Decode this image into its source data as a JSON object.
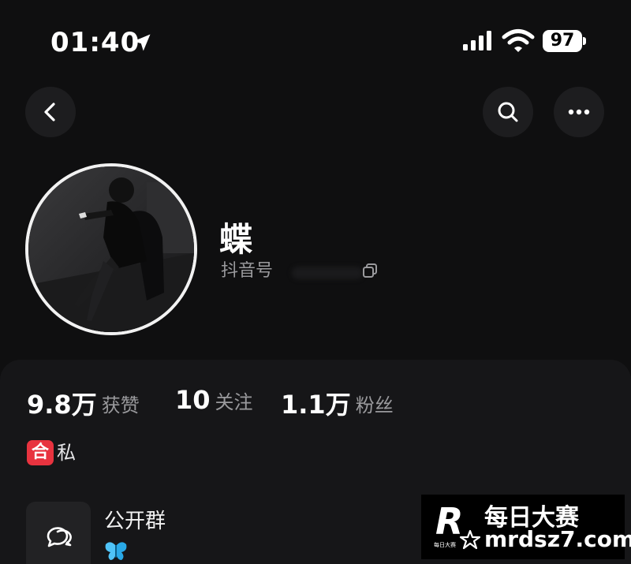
{
  "status_bar": {
    "time": "01:40",
    "battery": "97",
    "location_icon": "location-arrow-icon",
    "signal_icon": "cellular-signal-icon",
    "wifi_icon": "wifi-icon"
  },
  "nav": {
    "back_icon": "chevron-left-icon",
    "search_icon": "search-icon",
    "more_icon": "more-dots-icon"
  },
  "profile": {
    "name": "蝶",
    "id_label": "抖音号",
    "copy_icon": "copy-icon"
  },
  "stats": [
    {
      "value": "9.8万",
      "label": "获赞"
    },
    {
      "value": "10",
      "label": "关注"
    },
    {
      "value": "1.1万",
      "label": "粉丝"
    }
  ],
  "tag": {
    "badge": "合",
    "text": "私",
    "color": "#e8333f"
  },
  "group": {
    "title": "公开群",
    "icon": "chat-bubbles-icon",
    "emoji_icon": "butterfly-icon"
  },
  "watermark": {
    "chinese": "每日大赛",
    "url": "mrdsz7.com",
    "logo_letter": "R",
    "logo_sub": "每日大赛"
  },
  "colors": {
    "background": "#0f0f10",
    "panel": "#161618",
    "muted_text": "#9a9a9d"
  }
}
